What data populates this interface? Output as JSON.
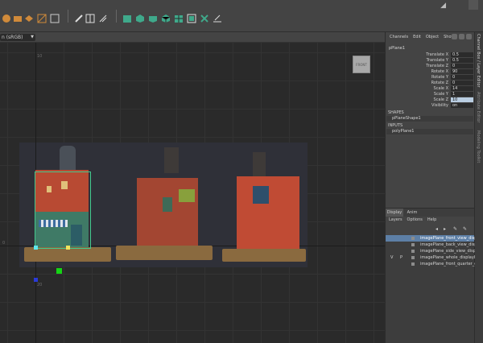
{
  "toolbar": {
    "groups": [
      {
        "icons": [
          "snap-to-grid-icon",
          "snap-to-curve-icon",
          "snap-to-point-icon",
          "snap-view-plane-icon",
          "make-live-icon"
        ]
      },
      {
        "icons": [
          "history-icon",
          "input-output-icon",
          "render-settings-icon"
        ]
      },
      {
        "icons": [
          "poly-plane-icon",
          "poly-cube-icon",
          "poly-sphere-icon",
          "poly-cylinder-icon",
          "poly-torus-icon",
          "uv-editor-icon",
          "symmetry-icon",
          "modeling-toolkit-icon"
        ]
      }
    ]
  },
  "viewport": {
    "colorspace_label": "n (sRGB)",
    "cube_label": "FRONT",
    "ruler_labels": [
      "10",
      "20",
      "0"
    ],
    "accent_green": "#43c98e"
  },
  "channel_box": {
    "menu": [
      "Channels",
      "Edit",
      "Object",
      "Show"
    ],
    "object_name": "pPlane1",
    "attributes": [
      {
        "label": "Translate X",
        "value": "0.5"
      },
      {
        "label": "Translate Y",
        "value": "0.5"
      },
      {
        "label": "Translate Z",
        "value": "0"
      },
      {
        "label": "Rotate X",
        "value": "90"
      },
      {
        "label": "Rotate Y",
        "value": "0"
      },
      {
        "label": "Rotate Z",
        "value": "0"
      },
      {
        "label": "Scale X",
        "value": "14"
      },
      {
        "label": "Scale Y",
        "value": "1"
      },
      {
        "label": "Scale Z",
        "value": "10"
      },
      {
        "label": "Visibility",
        "value": "on"
      }
    ],
    "shapes_title": "SHAPES",
    "shape_item": "pPlaneShape1",
    "inputs_title": "INPUTS",
    "input_item": "polyPlane1"
  },
  "side_tabs": [
    "Channel Box / Layer Editor",
    "Attribute Editor",
    "Modeling Toolkit"
  ],
  "layer_editor": {
    "tabs": [
      "Display",
      "Anim"
    ],
    "menu": [
      "Layers",
      "Options",
      "Help"
    ],
    "layers": [
      {
        "v": "",
        "p": "",
        "name": "imagePlane_front_view_displayLayer",
        "selected": true
      },
      {
        "v": "",
        "p": "",
        "name": "imagePlane_back_view_displayLayer",
        "selected": false
      },
      {
        "v": "",
        "p": "",
        "name": "imagePlane_side_view_displayLayer",
        "selected": false
      },
      {
        "v": "V",
        "p": "P",
        "name": "imagePlane_whole_displayLayer",
        "selected": false
      },
      {
        "v": "",
        "p": "",
        "name": "imagePlane_front_quarter_displayLayer",
        "selected": false
      }
    ]
  }
}
